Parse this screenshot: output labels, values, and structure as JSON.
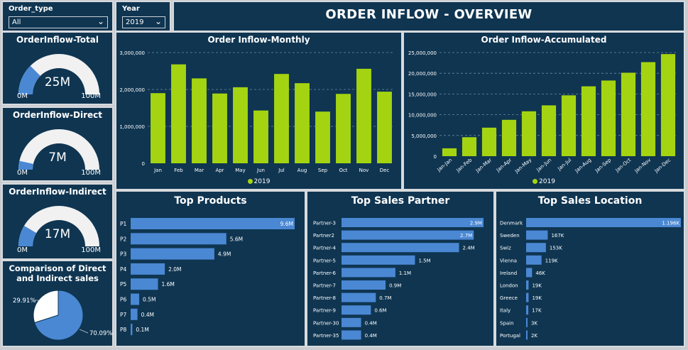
{
  "header": {
    "title": "ORDER INFLOW - OVERVIEW"
  },
  "filters": {
    "order_type": {
      "label": "Order_type",
      "value": "All"
    },
    "year": {
      "label": "Year",
      "value": "2019"
    }
  },
  "gauges": [
    {
      "title": "OrderInflow-Total",
      "value": "25M",
      "min": "0M",
      "max": "100M",
      "fraction": 0.25
    },
    {
      "title": "OrderInflow-Direct",
      "value": "7M",
      "min": "0M",
      "max": "100M",
      "fraction": 0.07
    },
    {
      "title": "OrderInflow-Indirect",
      "value": "17M",
      "min": "0M",
      "max": "100M",
      "fraction": 0.17
    }
  ],
  "pie": {
    "title": "Comparison of Direct and Indirect sales",
    "labels": [
      "29.91%",
      "70.09%"
    ],
    "values": [
      29.91,
      70.09
    ]
  },
  "colors": {
    "panel": "#0f3551",
    "green": "#a4d411",
    "blue": "#4a88d4",
    "gauge_bg": "#f1f1f1"
  },
  "chart_data": [
    {
      "type": "bar",
      "title": "Order Inflow-Monthly",
      "categories": [
        "Jan",
        "Feb",
        "Mar",
        "Apr",
        "May",
        "Jun",
        "Jul",
        "Aug",
        "Sep",
        "Oct",
        "Nov",
        "Dec"
      ],
      "series": [
        {
          "name": "2019",
          "values": [
            1900000,
            2680000,
            2300000,
            1890000,
            2060000,
            1430000,
            2420000,
            2170000,
            1400000,
            1880000,
            2560000,
            1940000
          ]
        }
      ],
      "ylim": [
        0,
        3000000
      ],
      "yticks": [
        "0",
        "1,000,000",
        "2,000,000",
        "3,000,000"
      ],
      "legend": "bottom"
    },
    {
      "type": "bar",
      "title": "Order Inflow-Accumulated",
      "categories": [
        "Jan-Jan",
        "Jan-Feb",
        "Jan-Mar",
        "Jan-Apr",
        "Jan-May",
        "Jan-Jun",
        "Jan-Jul",
        "Jan-Aug",
        "Jan-Sep",
        "Jan-Oct",
        "Jan-Nov",
        "Jan-Dec"
      ],
      "series": [
        {
          "name": "2019",
          "values": [
            1900000,
            4580000,
            6880000,
            8770000,
            10830000,
            12260000,
            14680000,
            16850000,
            18250000,
            20130000,
            22690000,
            24630000
          ]
        }
      ],
      "ylim": [
        0,
        25000000
      ],
      "yticks": [
        "0",
        "5,000,000",
        "10,000,000",
        "15,000,000",
        "20,000,000",
        "25,000,000"
      ],
      "legend": "bottom"
    },
    {
      "type": "bar",
      "orientation": "horizontal",
      "title": "Top Products",
      "categories": [
        "P1",
        "P2",
        "P3",
        "P4",
        "P5",
        "P6",
        "P7",
        "P8"
      ],
      "values": [
        9.6,
        5.6,
        4.9,
        2.0,
        1.6,
        0.5,
        0.4,
        0.1
      ],
      "labels": [
        "9.6M",
        "5.6M",
        "4.9M",
        "2.0M",
        "1.6M",
        "0.5M",
        "0.4M",
        "0.1M"
      ]
    },
    {
      "type": "bar",
      "orientation": "horizontal",
      "title": "Top Sales Partner",
      "categories": [
        "Partner-3",
        "Partner2",
        "Partner-4",
        "Partner-5",
        "Partner-6",
        "Partner-7",
        "Partner-8",
        "Partner-9",
        "Partner-30",
        "Partner-35"
      ],
      "values": [
        2.9,
        2.7,
        2.4,
        1.5,
        1.1,
        0.9,
        0.7,
        0.6,
        0.4,
        0.4
      ],
      "labels": [
        "2.9M",
        "2.7M",
        "2.4M",
        "1.5M",
        "1.1M",
        "0.9M",
        "0.7M",
        "0.6M",
        "0.4M",
        "0.4M"
      ]
    },
    {
      "type": "bar",
      "orientation": "horizontal",
      "title": "Top Sales Location",
      "categories": [
        "Denmark",
        "Sweden",
        "Swiz",
        "Vienna",
        "Ireland",
        "London",
        "Greece",
        "Italy",
        "Spain",
        "Portugal"
      ],
      "values": [
        1196,
        167,
        153,
        119,
        46,
        19,
        19,
        17,
        3,
        2
      ],
      "labels": [
        "1.196K",
        "167K",
        "153K",
        "119K",
        "46K",
        "19K",
        "19K",
        "17K",
        "3K",
        "2K"
      ]
    }
  ]
}
